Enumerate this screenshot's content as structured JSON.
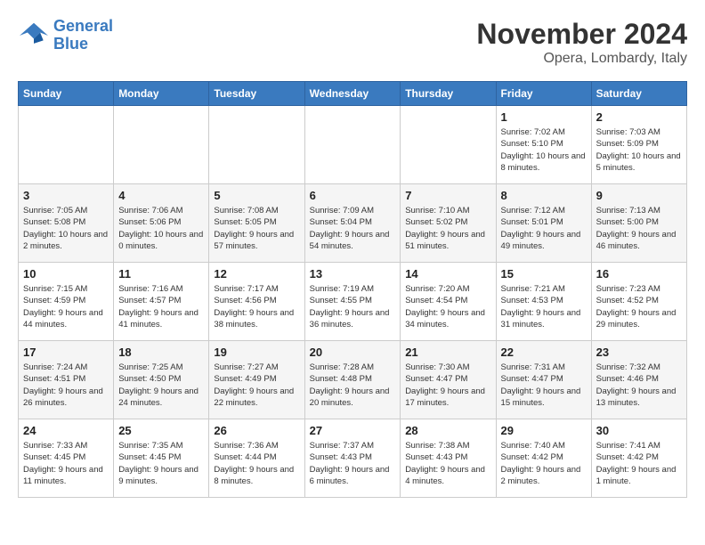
{
  "header": {
    "logo_line1": "General",
    "logo_line2": "Blue",
    "month_title": "November 2024",
    "location": "Opera, Lombardy, Italy"
  },
  "weekdays": [
    "Sunday",
    "Monday",
    "Tuesday",
    "Wednesday",
    "Thursday",
    "Friday",
    "Saturday"
  ],
  "weeks": [
    [
      {
        "day": "",
        "info": ""
      },
      {
        "day": "",
        "info": ""
      },
      {
        "day": "",
        "info": ""
      },
      {
        "day": "",
        "info": ""
      },
      {
        "day": "",
        "info": ""
      },
      {
        "day": "1",
        "info": "Sunrise: 7:02 AM\nSunset: 5:10 PM\nDaylight: 10 hours and 8 minutes."
      },
      {
        "day": "2",
        "info": "Sunrise: 7:03 AM\nSunset: 5:09 PM\nDaylight: 10 hours and 5 minutes."
      }
    ],
    [
      {
        "day": "3",
        "info": "Sunrise: 7:05 AM\nSunset: 5:08 PM\nDaylight: 10 hours and 2 minutes."
      },
      {
        "day": "4",
        "info": "Sunrise: 7:06 AM\nSunset: 5:06 PM\nDaylight: 10 hours and 0 minutes."
      },
      {
        "day": "5",
        "info": "Sunrise: 7:08 AM\nSunset: 5:05 PM\nDaylight: 9 hours and 57 minutes."
      },
      {
        "day": "6",
        "info": "Sunrise: 7:09 AM\nSunset: 5:04 PM\nDaylight: 9 hours and 54 minutes."
      },
      {
        "day": "7",
        "info": "Sunrise: 7:10 AM\nSunset: 5:02 PM\nDaylight: 9 hours and 51 minutes."
      },
      {
        "day": "8",
        "info": "Sunrise: 7:12 AM\nSunset: 5:01 PM\nDaylight: 9 hours and 49 minutes."
      },
      {
        "day": "9",
        "info": "Sunrise: 7:13 AM\nSunset: 5:00 PM\nDaylight: 9 hours and 46 minutes."
      }
    ],
    [
      {
        "day": "10",
        "info": "Sunrise: 7:15 AM\nSunset: 4:59 PM\nDaylight: 9 hours and 44 minutes."
      },
      {
        "day": "11",
        "info": "Sunrise: 7:16 AM\nSunset: 4:57 PM\nDaylight: 9 hours and 41 minutes."
      },
      {
        "day": "12",
        "info": "Sunrise: 7:17 AM\nSunset: 4:56 PM\nDaylight: 9 hours and 38 minutes."
      },
      {
        "day": "13",
        "info": "Sunrise: 7:19 AM\nSunset: 4:55 PM\nDaylight: 9 hours and 36 minutes."
      },
      {
        "day": "14",
        "info": "Sunrise: 7:20 AM\nSunset: 4:54 PM\nDaylight: 9 hours and 34 minutes."
      },
      {
        "day": "15",
        "info": "Sunrise: 7:21 AM\nSunset: 4:53 PM\nDaylight: 9 hours and 31 minutes."
      },
      {
        "day": "16",
        "info": "Sunrise: 7:23 AM\nSunset: 4:52 PM\nDaylight: 9 hours and 29 minutes."
      }
    ],
    [
      {
        "day": "17",
        "info": "Sunrise: 7:24 AM\nSunset: 4:51 PM\nDaylight: 9 hours and 26 minutes."
      },
      {
        "day": "18",
        "info": "Sunrise: 7:25 AM\nSunset: 4:50 PM\nDaylight: 9 hours and 24 minutes."
      },
      {
        "day": "19",
        "info": "Sunrise: 7:27 AM\nSunset: 4:49 PM\nDaylight: 9 hours and 22 minutes."
      },
      {
        "day": "20",
        "info": "Sunrise: 7:28 AM\nSunset: 4:48 PM\nDaylight: 9 hours and 20 minutes."
      },
      {
        "day": "21",
        "info": "Sunrise: 7:30 AM\nSunset: 4:47 PM\nDaylight: 9 hours and 17 minutes."
      },
      {
        "day": "22",
        "info": "Sunrise: 7:31 AM\nSunset: 4:47 PM\nDaylight: 9 hours and 15 minutes."
      },
      {
        "day": "23",
        "info": "Sunrise: 7:32 AM\nSunset: 4:46 PM\nDaylight: 9 hours and 13 minutes."
      }
    ],
    [
      {
        "day": "24",
        "info": "Sunrise: 7:33 AM\nSunset: 4:45 PM\nDaylight: 9 hours and 11 minutes."
      },
      {
        "day": "25",
        "info": "Sunrise: 7:35 AM\nSunset: 4:45 PM\nDaylight: 9 hours and 9 minutes."
      },
      {
        "day": "26",
        "info": "Sunrise: 7:36 AM\nSunset: 4:44 PM\nDaylight: 9 hours and 8 minutes."
      },
      {
        "day": "27",
        "info": "Sunrise: 7:37 AM\nSunset: 4:43 PM\nDaylight: 9 hours and 6 minutes."
      },
      {
        "day": "28",
        "info": "Sunrise: 7:38 AM\nSunset: 4:43 PM\nDaylight: 9 hours and 4 minutes."
      },
      {
        "day": "29",
        "info": "Sunrise: 7:40 AM\nSunset: 4:42 PM\nDaylight: 9 hours and 2 minutes."
      },
      {
        "day": "30",
        "info": "Sunrise: 7:41 AM\nSunset: 4:42 PM\nDaylight: 9 hours and 1 minute."
      }
    ]
  ]
}
